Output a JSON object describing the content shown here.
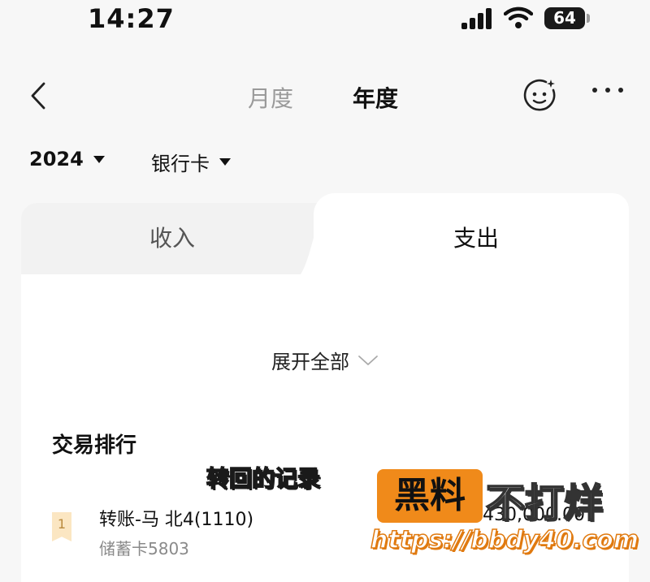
{
  "status_bar": {
    "time": "14:27",
    "battery": "64"
  },
  "nav": {
    "tab_monthly": "月度",
    "tab_yearly": "年度"
  },
  "filters": {
    "year": "2024",
    "account": "银行卡"
  },
  "type_tabs": {
    "income": "收入",
    "expense": "支出"
  },
  "expand_all": "展开全部",
  "ranking": {
    "title": "交易排行",
    "items": [
      {
        "rank": "1",
        "title": "转账-马 北4(1110)",
        "account": "储蓄卡5803",
        "amount": "430,000.00"
      }
    ]
  },
  "overlay": {
    "caption": "转回的记录",
    "logo": "黑料",
    "tagline": "不打烊",
    "url": "https://bbdy40.com"
  },
  "colors": {
    "accent_orange": "#f08a1a",
    "caption_yellow": "#f6c241",
    "muted_text": "#9a9a9a"
  }
}
